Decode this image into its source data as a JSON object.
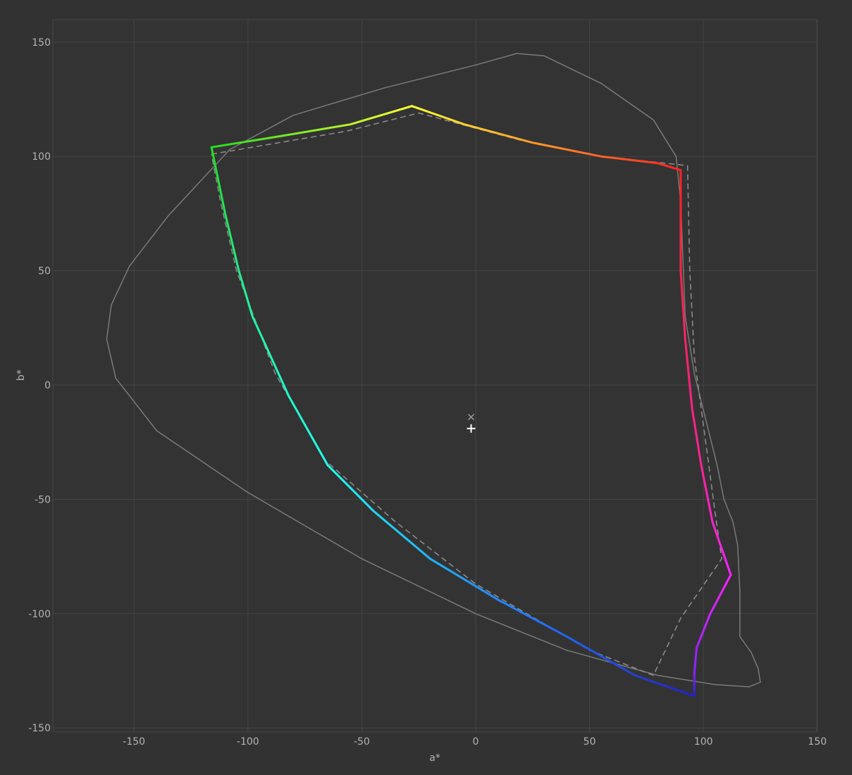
{
  "chart_data": {
    "type": "line",
    "title": "",
    "xlabel": "a*",
    "ylabel": "b*",
    "xlim": [
      -185,
      150
    ],
    "ylim": [
      -152,
      160
    ],
    "xticks": [
      -150,
      -100,
      -50,
      0,
      50,
      100,
      150
    ],
    "yticks": [
      -150,
      -100,
      -50,
      0,
      50,
      100,
      150
    ],
    "grid": true,
    "colors": {
      "background": "#323232",
      "grid": "#444444",
      "axis_text": "#b4b4b4",
      "outline": "#7a7a7a",
      "reference": "#8a8a8a",
      "markers": "#c8c8c8"
    },
    "series": [
      {
        "style": "solid-thin",
        "color": "#7a7a7a",
        "points": [
          [
            -162,
            20
          ],
          [
            -160,
            35
          ],
          [
            -152,
            52
          ],
          [
            -135,
            74
          ],
          [
            -108,
            103
          ],
          [
            -80,
            118
          ],
          [
            -40,
            130
          ],
          [
            0,
            140
          ],
          [
            18,
            145
          ],
          [
            30,
            144
          ],
          [
            55,
            132
          ],
          [
            78,
            116
          ],
          [
            88,
            100
          ],
          [
            90,
            80
          ],
          [
            91,
            55
          ],
          [
            92,
            30
          ],
          [
            96,
            5
          ],
          [
            101,
            -15
          ],
          [
            106,
            -35
          ],
          [
            109,
            -50
          ],
          [
            113,
            -60
          ],
          [
            115,
            -70
          ],
          [
            116,
            -90
          ],
          [
            116,
            -110
          ],
          [
            121,
            -117
          ],
          [
            124,
            -124
          ],
          [
            125,
            -130
          ],
          [
            120,
            -132
          ],
          [
            105,
            -131
          ],
          [
            80,
            -127
          ],
          [
            40,
            -116
          ],
          [
            0,
            -100
          ],
          [
            -50,
            -76
          ],
          [
            -100,
            -47
          ],
          [
            -140,
            -20
          ],
          [
            -158,
            3
          ],
          [
            -162,
            20
          ]
        ]
      },
      {
        "style": "dashed",
        "color": "#8a8a8a",
        "points": [
          [
            -116,
            101
          ],
          [
            -57,
            111
          ],
          [
            -25,
            119
          ],
          [
            20,
            107
          ],
          [
            55,
            100
          ],
          [
            93,
            96
          ],
          [
            94,
            50
          ],
          [
            96,
            12
          ],
          [
            101,
            -25
          ],
          [
            105,
            -55
          ],
          [
            108,
            -76
          ],
          [
            90,
            -102
          ],
          [
            78,
            -127
          ],
          [
            50,
            -116
          ],
          [
            0,
            -87
          ],
          [
            -35,
            -60
          ],
          [
            -66,
            -33
          ],
          [
            -88,
            5
          ],
          [
            -105,
            50
          ],
          [
            -112,
            80
          ],
          [
            -116,
            101
          ]
        ]
      },
      {
        "style": "solid-thick",
        "segments": [
          {
            "from": "#22dd22",
            "to": "#ffff33",
            "points": [
              [
                -116,
                104
              ],
              [
                -85,
                109
              ],
              [
                -55,
                114
              ],
              [
                -28,
                122
              ]
            ]
          },
          {
            "from": "#ffff33",
            "to": "#ff2222",
            "points": [
              [
                -28,
                122
              ],
              [
                -5,
                114
              ],
              [
                25,
                106
              ],
              [
                55,
                100
              ],
              [
                80,
                97
              ],
              [
                90,
                94
              ]
            ]
          },
          {
            "from": "#ff2222",
            "to": "#ff2299",
            "points": [
              [
                90,
                94
              ],
              [
                90,
                80
              ],
              [
                90,
                50
              ],
              [
                92,
                20
              ],
              [
                95,
                -10
              ],
              [
                99,
                -35
              ]
            ]
          },
          {
            "from": "#ff2299",
            "to": "#ff22ff",
            "points": [
              [
                99,
                -35
              ],
              [
                104,
                -60
              ],
              [
                112,
                -83
              ]
            ]
          },
          {
            "from": "#ff22ff",
            "to": "#8822ff",
            "points": [
              [
                112,
                -83
              ],
              [
                103,
                -100
              ],
              [
                97,
                -115
              ],
              [
                96,
                -126
              ]
            ]
          },
          {
            "from": "#8822ff",
            "to": "#2222cc",
            "points": [
              [
                96,
                -126
              ],
              [
                96,
                -136
              ]
            ]
          },
          {
            "from": "#2222cc",
            "to": "#2288ff",
            "points": [
              [
                96,
                -136
              ],
              [
                70,
                -127
              ],
              [
                40,
                -110
              ],
              [
                10,
                -94
              ]
            ]
          },
          {
            "from": "#2288ff",
            "to": "#22ffee",
            "points": [
              [
                10,
                -94
              ],
              [
                -20,
                -76
              ],
              [
                -45,
                -55
              ],
              [
                -65,
                -35
              ]
            ]
          },
          {
            "from": "#22ffee",
            "to": "#22ee88",
            "points": [
              [
                -65,
                -35
              ],
              [
                -82,
                -5
              ],
              [
                -98,
                30
              ],
              [
                -104,
                50
              ]
            ]
          },
          {
            "from": "#22ee88",
            "to": "#22dd22",
            "points": [
              [
                -104,
                50
              ],
              [
                -110,
                75
              ],
              [
                -116,
                104
              ]
            ]
          }
        ]
      }
    ],
    "markers": [
      {
        "symbol": "×",
        "a": -2,
        "b": -14,
        "color": "#9a9a9a"
      },
      {
        "symbol": "+",
        "a": -2,
        "b": -19,
        "color": "#ffffff"
      }
    ]
  }
}
